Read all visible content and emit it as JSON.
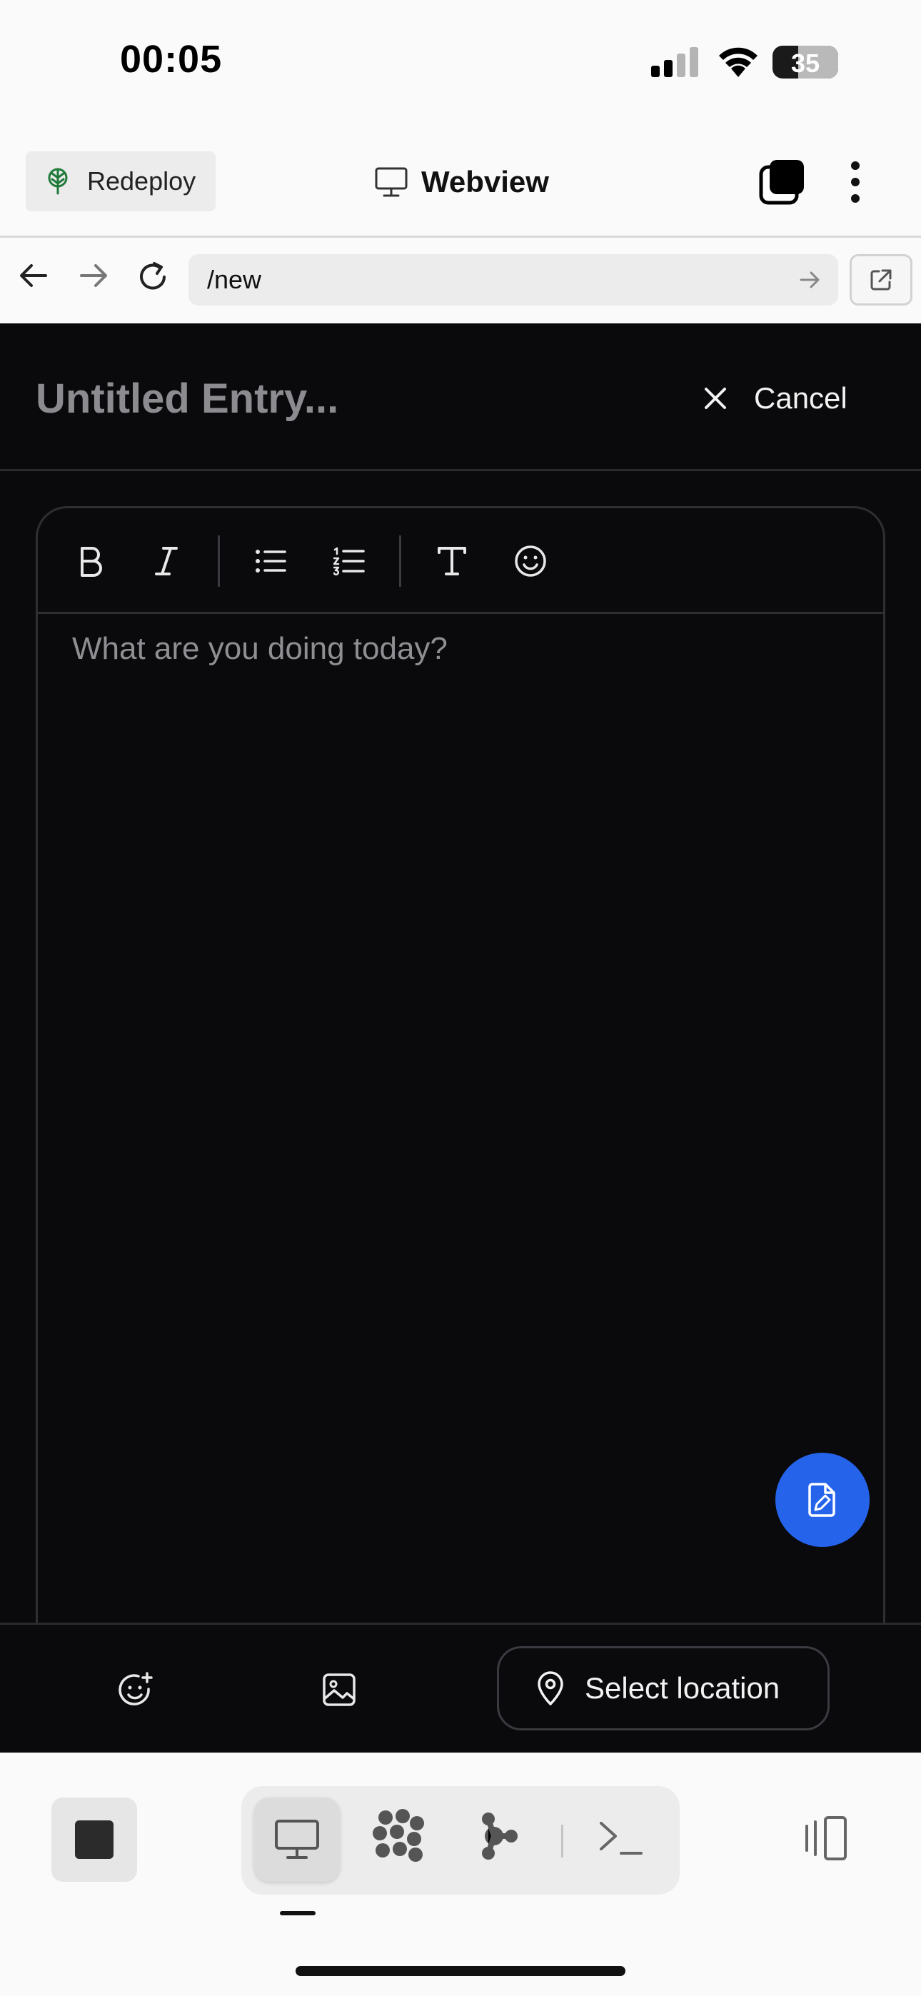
{
  "status_bar": {
    "time": "00:05",
    "battery": "35",
    "icons": [
      "signal-icon",
      "wifi-icon",
      "battery-icon"
    ]
  },
  "toolbar": {
    "redeploy_label": "Redeploy",
    "title": "Webview",
    "icons": [
      "tree-icon",
      "monitor-icon",
      "tabs-icon",
      "more-icon"
    ]
  },
  "nav": {
    "url": "/new",
    "icons": [
      "back-icon",
      "forward-icon",
      "reload-icon",
      "url-go-icon",
      "open-external-icon"
    ]
  },
  "page": {
    "entry_title_placeholder": "Untitled Entry...",
    "cancel_label": "Cancel",
    "editor_placeholder": "What are you doing today?",
    "editor_toolbar": [
      "bold-icon",
      "italic-icon",
      "bullet-list-icon",
      "numbered-list-icon",
      "text-style-icon",
      "emoji-icon"
    ],
    "location_label": "Select location",
    "accent_color": "#2563eb"
  },
  "dock": {
    "modes": [
      "desktop-icon",
      "grid-dots-icon",
      "branch-icon",
      "terminal-icon"
    ],
    "icons": [
      "stop-icon",
      "rotate-device-icon"
    ]
  }
}
